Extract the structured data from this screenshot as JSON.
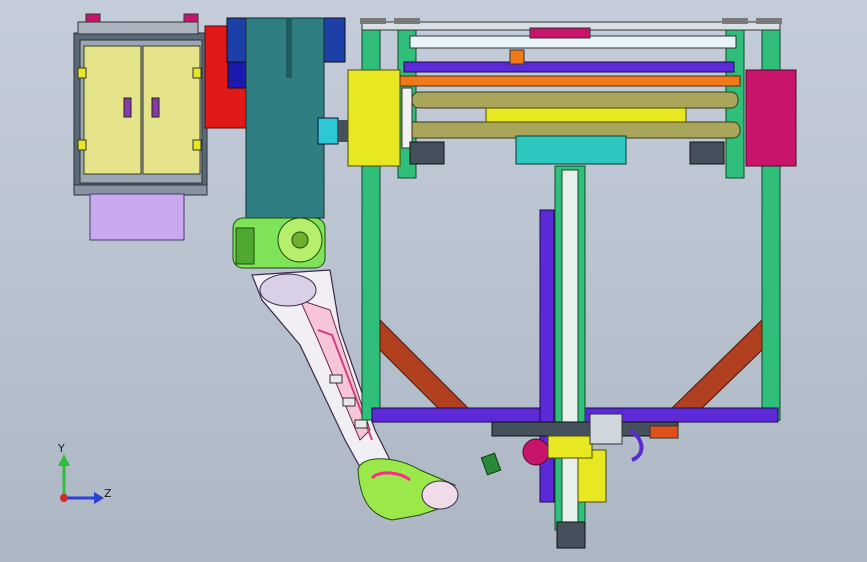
{
  "viewport": {
    "background_top": "#c4cdd9",
    "background_bottom": "#adb6c3"
  },
  "triad": {
    "y_label": "Y",
    "z_label": "Z",
    "y_color": "#2fbf3a",
    "z_color": "#2a40d6",
    "x_color": "#d02a2a"
  },
  "components": {
    "cabinet_color": "#e6e48a",
    "column_color": "#2f7f82",
    "frame_color": "#2fbf7a",
    "robot_arm_color": "#f1eef4",
    "robot_base_color": "#7fe35a",
    "roller_color": "#a9a55a",
    "side_yellow": "#e8e822",
    "side_magenta": "#c8146a",
    "beam_purple": "#5b2ad6",
    "brace_brown": "#b04020",
    "motor_red": "#e01818",
    "box_lilac": "#c8a8ee"
  }
}
